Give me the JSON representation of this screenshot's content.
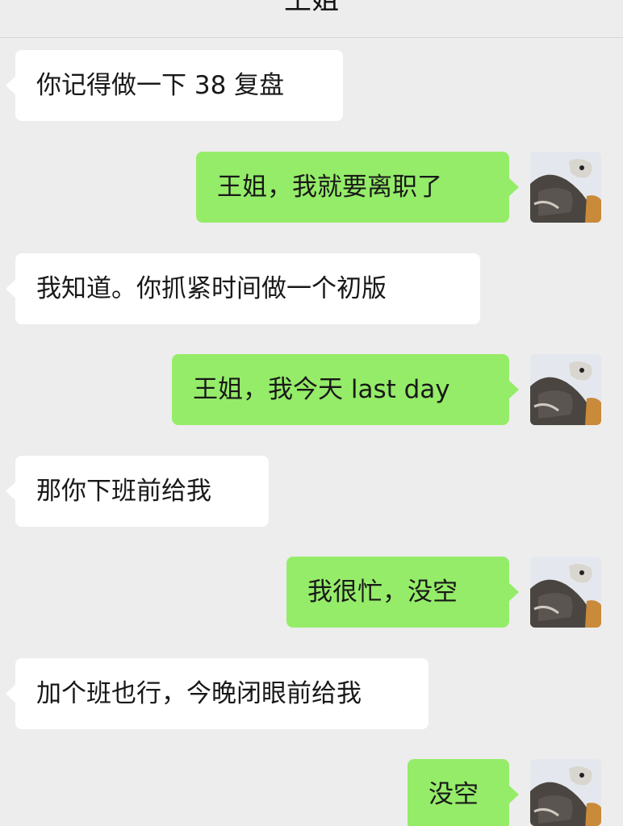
{
  "header": {
    "title": "王姐",
    "more_icon": "more-dots-icon",
    "more_label": "···"
  },
  "messages": [
    {
      "side": "incoming",
      "text": "你记得做一下 38 复盘"
    },
    {
      "side": "outgoing",
      "text": "王姐，我就要离职了"
    },
    {
      "side": "incoming",
      "text": "我知道。你抓紧时间做一个初版"
    },
    {
      "side": "outgoing",
      "text": "王姐，我今天 last day"
    },
    {
      "side": "incoming",
      "text": "那你下班前给我"
    },
    {
      "side": "outgoing",
      "text": "我很忙，没空"
    },
    {
      "side": "incoming",
      "text": "加个班也行，今晚闭眼前给我"
    },
    {
      "side": "outgoing",
      "text": "没空"
    }
  ],
  "colors": {
    "background": "#ededed",
    "incoming_bubble": "#ffffff",
    "outgoing_bubble": "#95ec69",
    "text": "#191919"
  },
  "avatar_icon": "cat-photo-avatar-icon"
}
